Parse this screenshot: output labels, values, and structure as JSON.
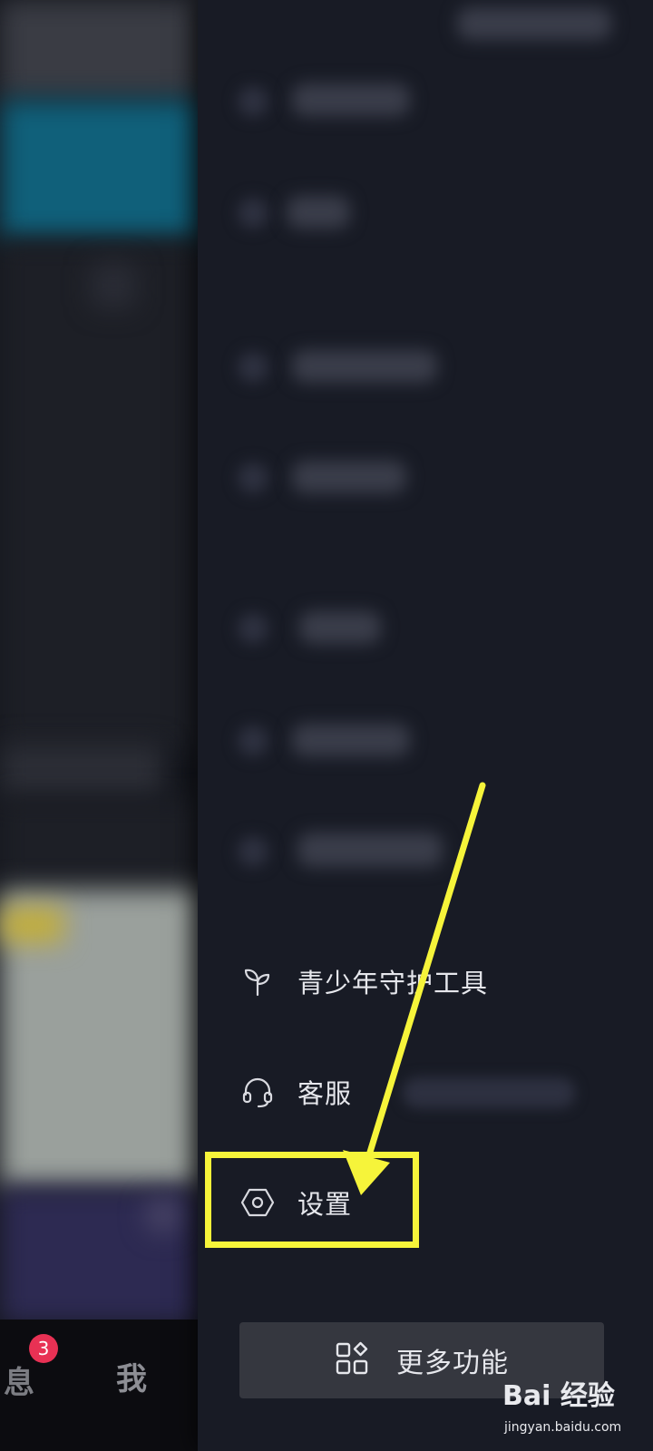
{
  "bottom_nav": {
    "messages_label": "息",
    "messages_badge": "3",
    "me_label": "我"
  },
  "drawer": {
    "items": [
      {
        "label": "青少年守护工具",
        "icon": "sprout-icon"
      },
      {
        "label": "客服",
        "icon": "headset-icon"
      },
      {
        "label": "设置",
        "icon": "hexagon-settings-icon"
      }
    ],
    "more_button": {
      "label": "更多功能",
      "icon": "grid-apps-icon"
    }
  },
  "annotation": {
    "color": "#f6f43a"
  },
  "watermark": {
    "main": "Bai 经验",
    "sub": "jingyan.baidu.com"
  }
}
